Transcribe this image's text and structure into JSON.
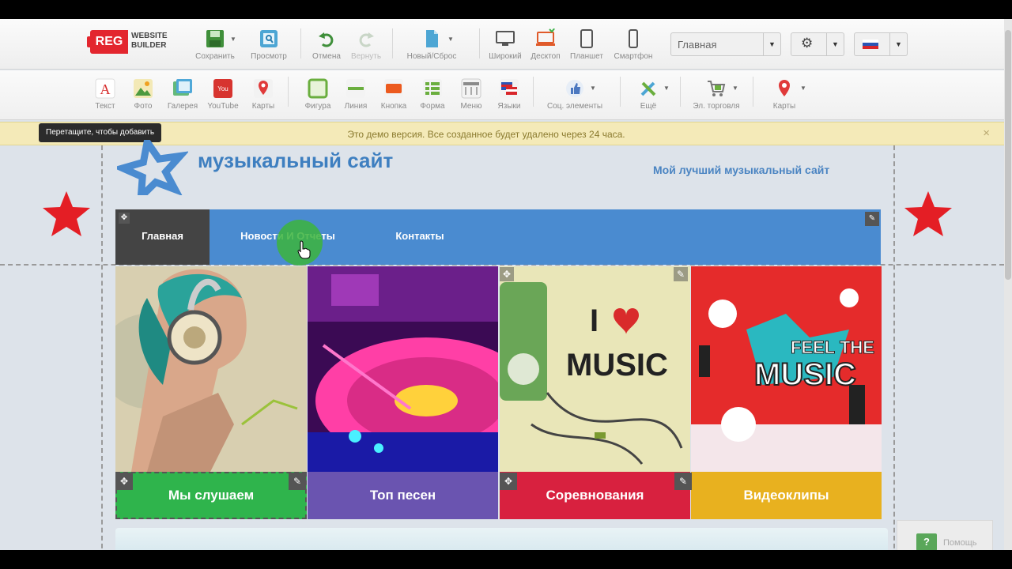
{
  "toolbar_top": {
    "logo_reg": "REG",
    "logo_line1": "WEBSITE",
    "logo_line2": "BUILDER",
    "save": "Сохранить",
    "preview": "Просмотр",
    "undo": "Отмена",
    "redo": "Вернуть",
    "new_reset": "Новый/Сброс",
    "wide": "Широкий",
    "desktop": "Десктоп",
    "tablet": "Планшет",
    "smartphone": "Смартфон",
    "page_select": "Главная"
  },
  "toolbar_elements": {
    "text": "Текст",
    "photo": "Фото",
    "gallery": "Галерея",
    "youtube": "YouTube",
    "maps": "Карты",
    "shape": "Фигура",
    "line": "Линия",
    "button": "Кнопка",
    "form": "Форма",
    "menu": "Меню",
    "languages": "Языки",
    "social": "Соц. элементы",
    "more": "Ещё",
    "ecommerce": "Эл. торговля",
    "maps2": "Карты"
  },
  "tooltip": "Перетащите, чтобы добавить",
  "demo_message": "Это демо версия. Все созданное будет удалено через 24 часа.",
  "site": {
    "title": "музыкальный сайт",
    "slogan": "Мой лучший музыкальный сайт",
    "nav": [
      "Главная",
      "Новости И Отчеты",
      "Контакты"
    ]
  },
  "tiles": [
    {
      "caption": "Мы слушаем",
      "color": "#2fb44c"
    },
    {
      "caption": "Топ песен",
      "color": "#6a54b0"
    },
    {
      "caption": "Соревнования",
      "color": "#d8213f"
    },
    {
      "caption": "Видеоклипы",
      "color": "#e8b11f"
    }
  ],
  "tile_art": {
    "i_love": "I",
    "music": "MUSIC",
    "feel_the": "FEEL THE",
    "music2": "MUSIC"
  },
  "help": "Помощь"
}
